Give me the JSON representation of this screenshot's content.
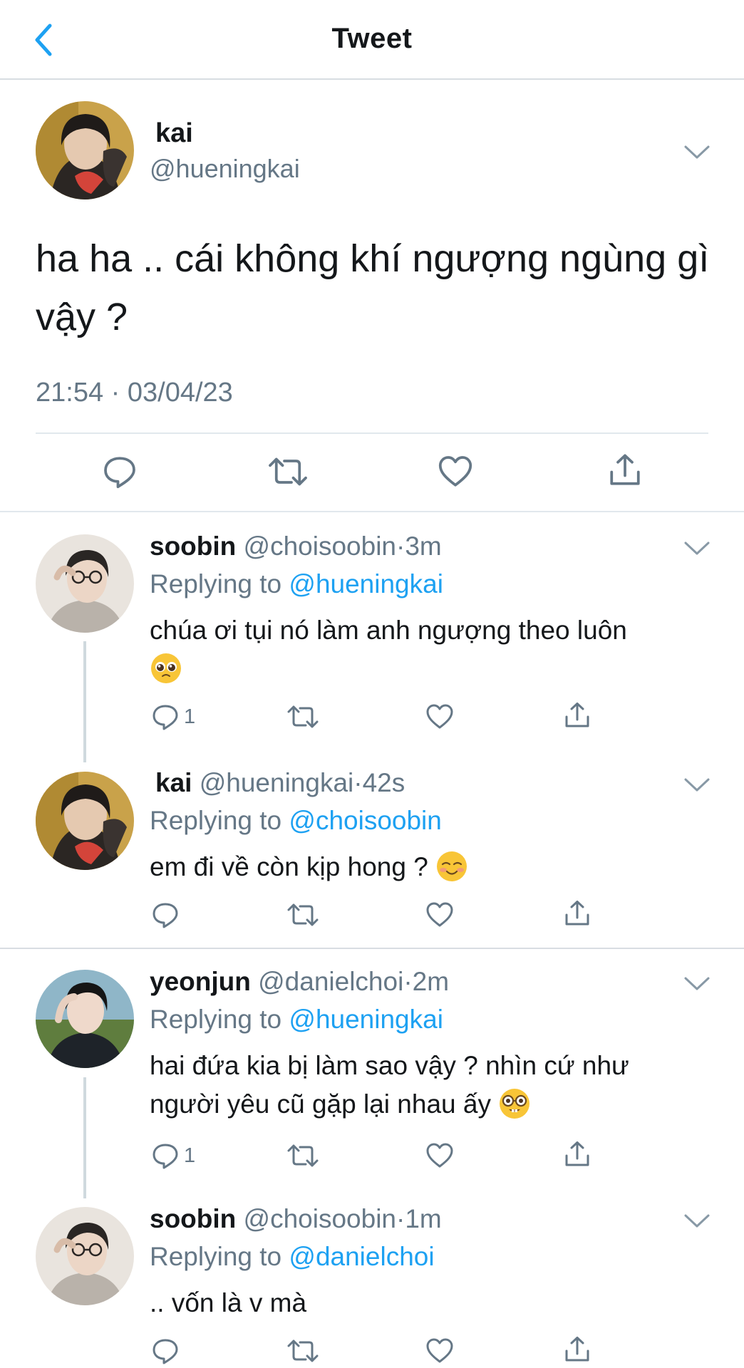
{
  "header": {
    "title": "Tweet"
  },
  "main_tweet": {
    "name": "kai",
    "handle": "@hueningkai",
    "text": "ha ha .. cái không khí ngượng ngùng gì vậy ?",
    "time": "21:54 · 03/04/23"
  },
  "replies": [
    {
      "name": "soobin",
      "handle": "@choisoobin",
      "sep": "·",
      "time": "3m",
      "replying_prefix": "Replying to ",
      "replying_to": "@hueningkai",
      "text": "chúa ơi tụi nó làm anh ngượng theo luôn",
      "emoji": "pleading-face",
      "reply_count": "1"
    },
    {
      "name": "kai",
      "handle": "@hueningkai",
      "sep": "·",
      "time": "42s",
      "replying_prefix": "Replying to ",
      "replying_to": "@choisoobin",
      "text": "em đi về còn kịp hong ?",
      "emoji": "smiling-face",
      "reply_count": ""
    },
    {
      "name": "yeonjun",
      "handle": "@danielchoi",
      "sep": "·",
      "time": "2m",
      "replying_prefix": "Replying to ",
      "replying_to": "@hueningkai",
      "text_line1": "hai đứa kia bị làm sao vậy ? nhìn cứ như",
      "text_line2": "người yêu cũ gặp lại nhau ấy",
      "emoji": "nerd-face",
      "reply_count": "1"
    },
    {
      "name": "soobin",
      "handle": "@choisoobin",
      "sep": "·",
      "time": "1m",
      "replying_prefix": "Replying to ",
      "replying_to": "@danielchoi",
      "text": ".. vốn là v mà",
      "reply_count": ""
    }
  ],
  "icons": {
    "back": "chevron-left-icon",
    "more": "chevron-down-icon",
    "reply": "comment-icon",
    "retweet": "retweet-icon",
    "like": "heart-icon",
    "share": "share-icon"
  },
  "colors": {
    "accent": "#1da1f2",
    "secondary_text": "#657786",
    "divider": "#e1e8ed"
  }
}
